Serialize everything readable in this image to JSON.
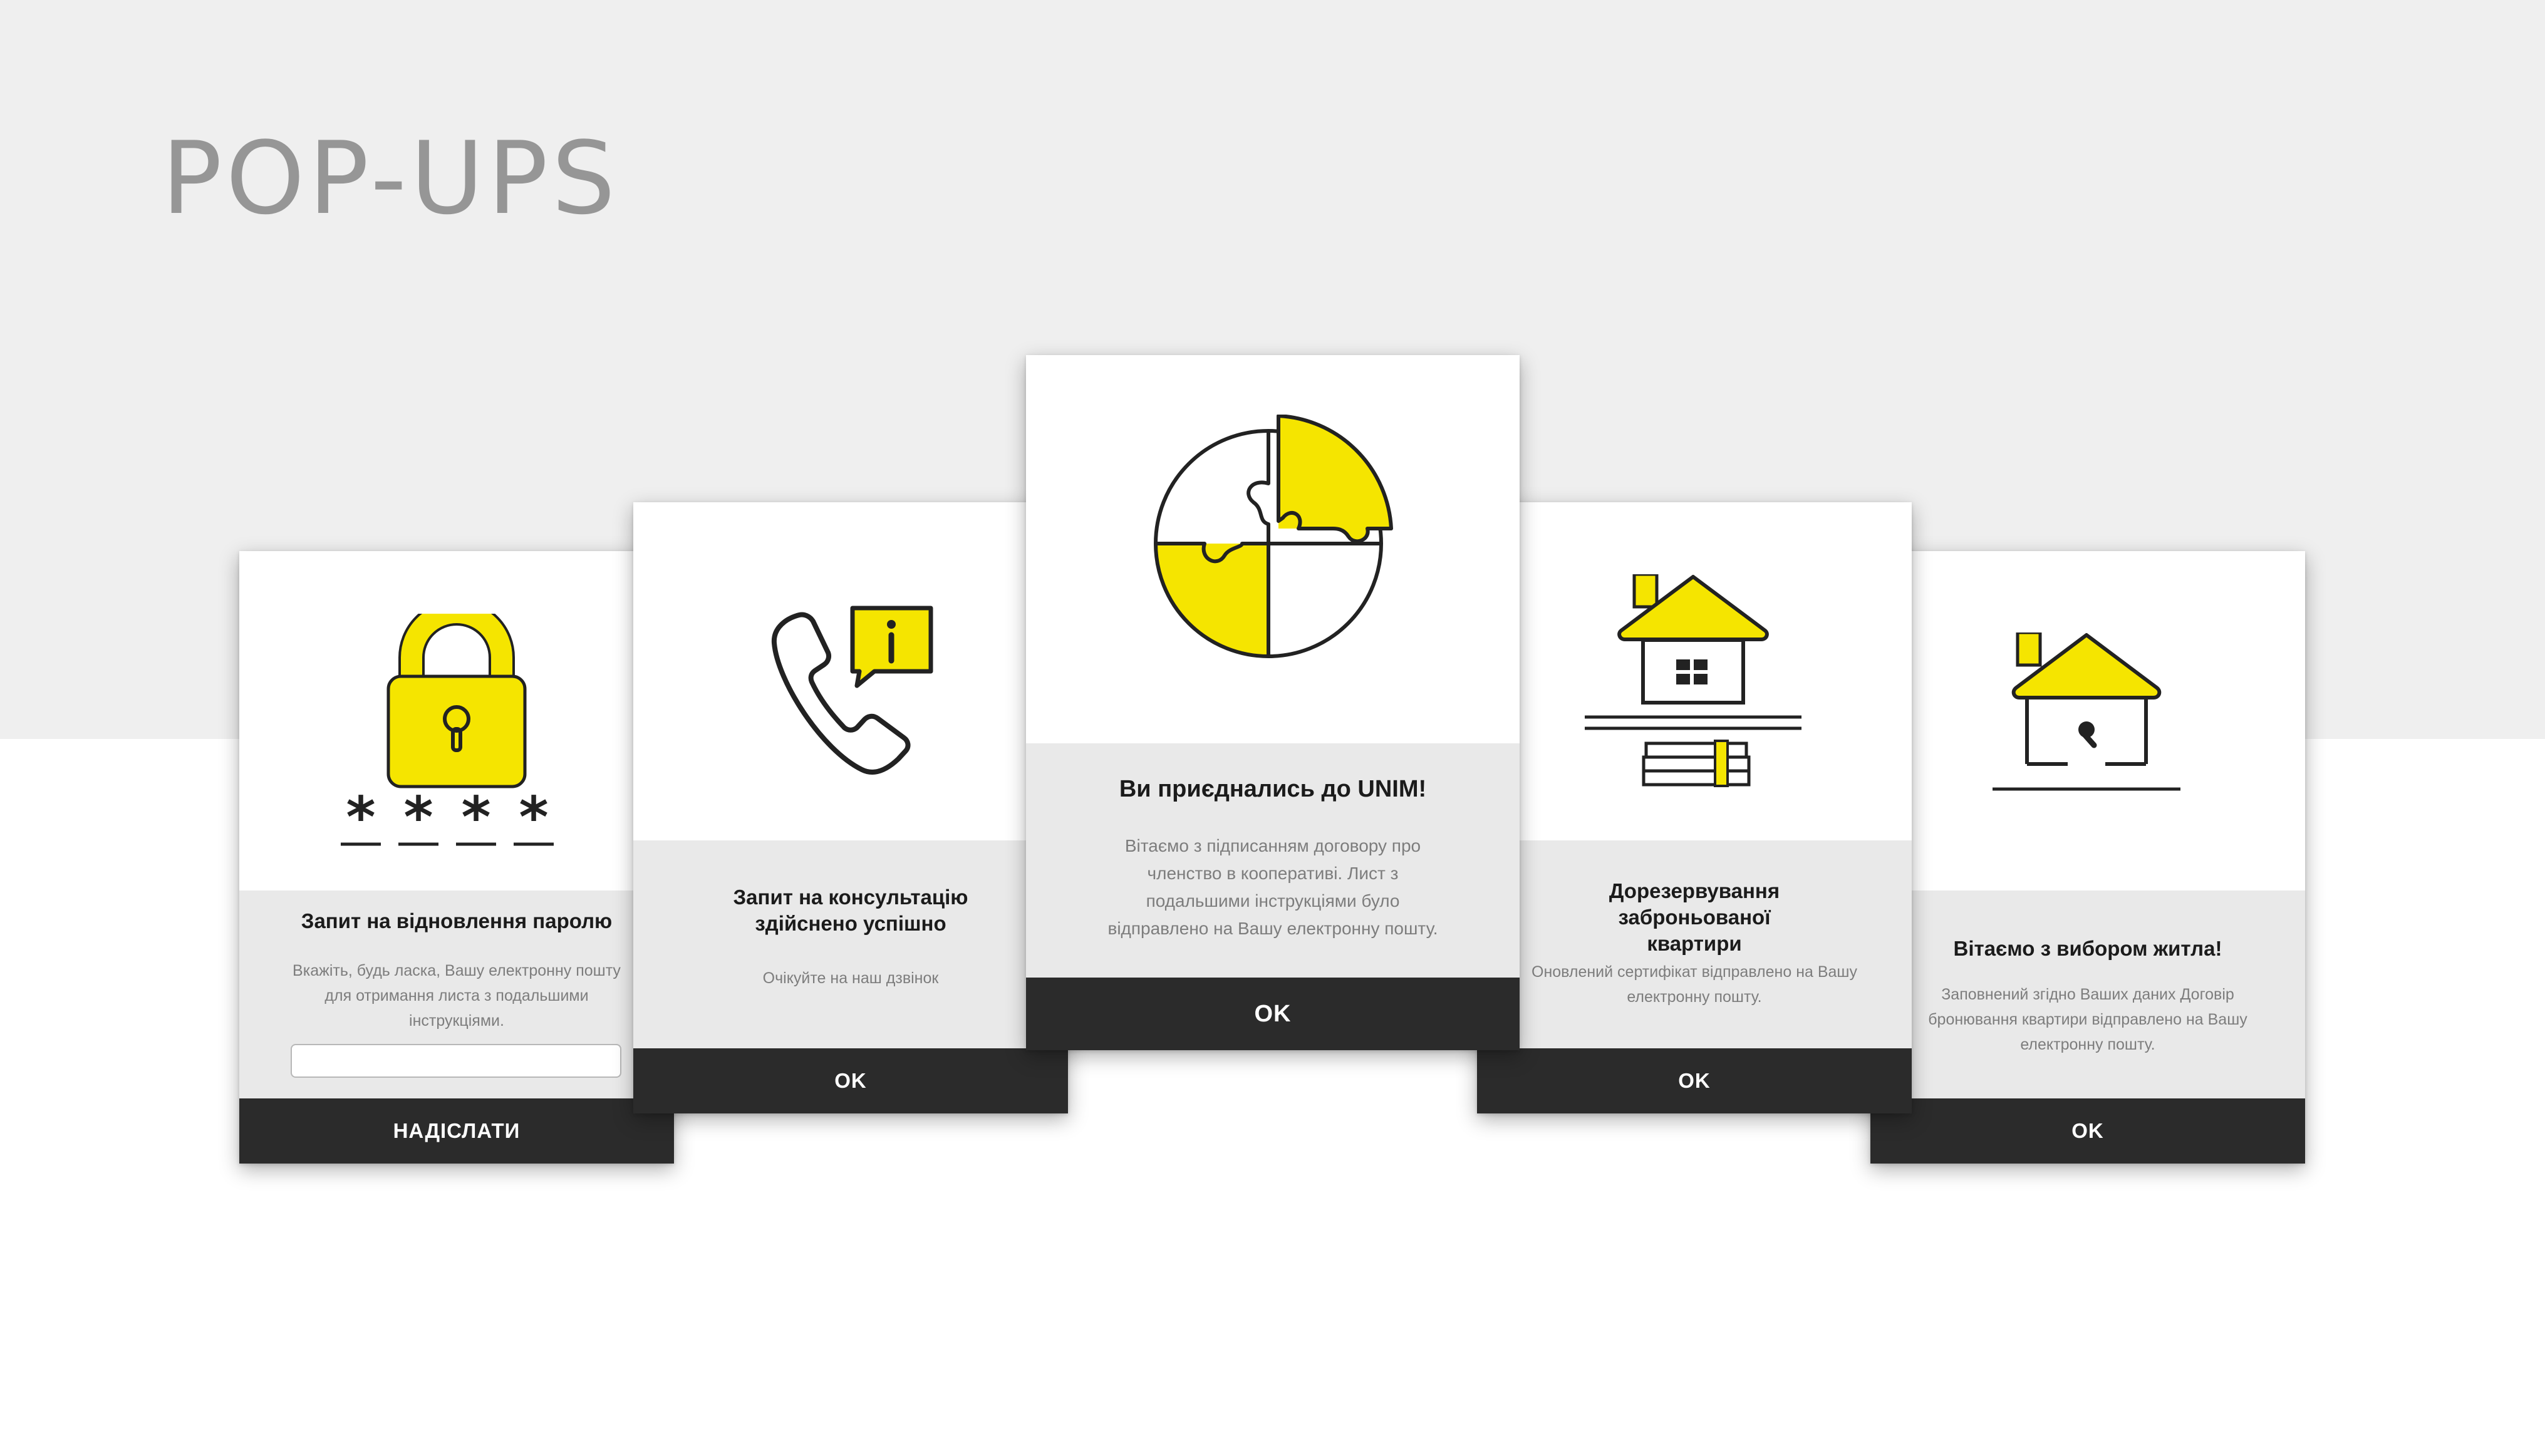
{
  "page": {
    "title": "POP-UPS"
  },
  "colors": {
    "accent": "#f5e500",
    "dark": "#2b2b2b",
    "muted_text": "#7d7d7d",
    "panel": "#e9e9e9",
    "band": "#efefef"
  },
  "popups": [
    {
      "icon": "unlock-padlock-password-icon",
      "title": "Запит на відновлення паролю",
      "message": "Вкажіть, будь ласка, Вашу електронну пошту для отримання листа з подальшими інструкціями.",
      "input_value": "",
      "button": "НАДІСЛАТИ"
    },
    {
      "icon": "phone-info-icon",
      "title": "Запит на консультацію здійснено успішно",
      "message": "Очікуйте на наш дзвінок",
      "button": "OK"
    },
    {
      "icon": "puzzle-circle-icon",
      "title": "Ви приєднались до UNIM!",
      "message": "Вітаємо з підписанням договору про членство в кооперативі. Лист з подальшими інструкціями було відправлено на Вашу електронну пошту.",
      "button": "OK"
    },
    {
      "icon": "house-money-stack-icon",
      "title": "Дорезервування заброньованої квартири",
      "message": "Оновлений сертифікат відправлено на Вашу електронну пошту.",
      "button": "OK"
    },
    {
      "icon": "house-keyhole-icon",
      "title": "Вітаємо з вибором житла!",
      "message": "Заповнений згідно Ваших даних Договір бронювання квартири відправлено на Вашу електронну пошту.",
      "button": "OK"
    }
  ]
}
